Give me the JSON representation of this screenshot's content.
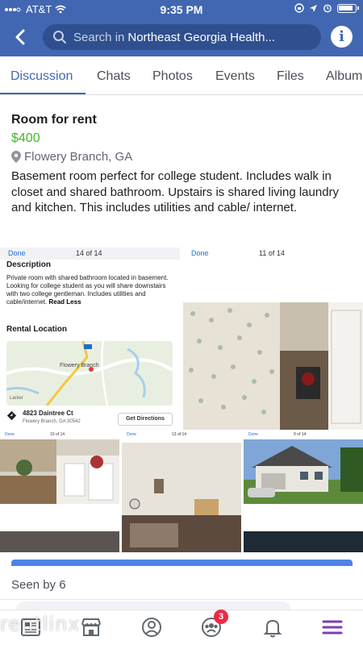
{
  "status_bar": {
    "carrier": "AT&T",
    "time": "9:35 PM"
  },
  "header": {
    "search_placeholder": "Search in",
    "group_name": "Northeast Georgia Health...",
    "info_label": "i"
  },
  "tabs": [
    {
      "label": "Discussion",
      "active": true
    },
    {
      "label": "Chats"
    },
    {
      "label": "Photos"
    },
    {
      "label": "Events"
    },
    {
      "label": "Files"
    },
    {
      "label": "Album"
    }
  ],
  "post": {
    "title": "Room for rent",
    "price": "$400",
    "location": "Flowery Branch, GA",
    "body": "Basement room perfect for college student. Includes walk in closet and shared bathroom. Upstairs is shared living laundry and kitchen. This includes utilities and cable/ internet."
  },
  "photos": {
    "p1": {
      "done": "Done",
      "count": "14 of 14",
      "description_heading": "Description",
      "description": "Private room with shared bathroom located in basement. Looking for college student as you will share downstairs with two college gentleman. Includes utilities and cable/internet.",
      "read_less": "Read Less",
      "rental_location_heading": "Rental Location",
      "map_city": "Flowery Branch",
      "map_lake": "Lanier",
      "address": "4823 Daintree Ct",
      "address_city": "Flowery Branch, GA 30542",
      "directions_button": "Get Directions"
    },
    "p2": {
      "done": "Done",
      "count": "11 of 14"
    },
    "p3": {
      "done": "Done",
      "count": "10 of 14"
    },
    "p4": {
      "done": "Done",
      "count": "13 of 14"
    },
    "p5": {
      "done": "Done",
      "count": "9 of 14"
    }
  },
  "seen_by": "Seen by 6",
  "bottom_nav": {
    "notifications_badge": "3",
    "items": [
      "news-feed-icon",
      "marketplace-icon",
      "profile-icon",
      "groups-icon",
      "notifications-icon",
      "menu-icon"
    ]
  },
  "watermark": "rentlinx",
  "colors": {
    "brand": "#4267b2",
    "price": "#42b72a",
    "badge": "#f02849"
  }
}
